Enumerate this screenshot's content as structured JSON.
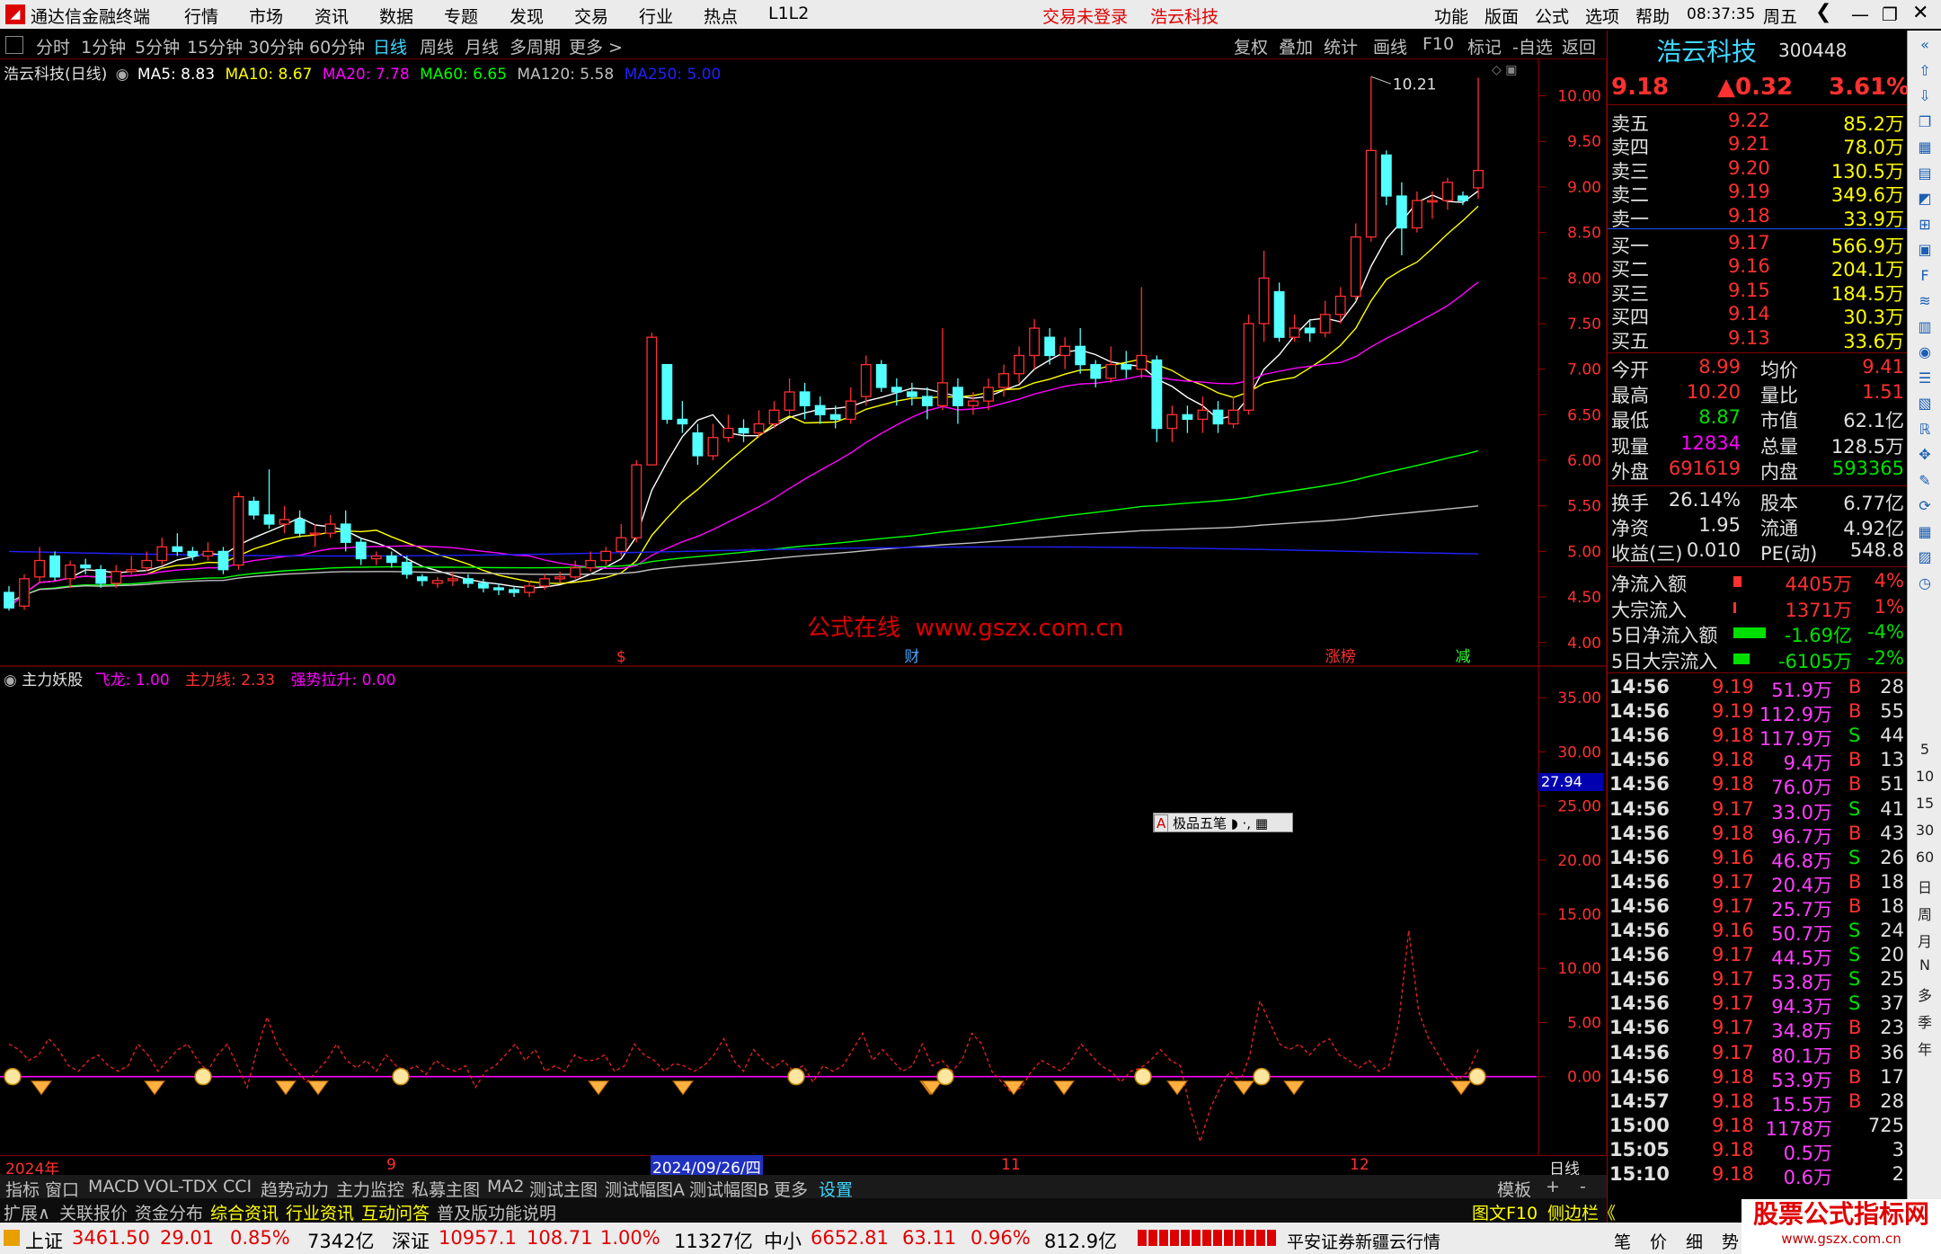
{
  "app": {
    "title": "通达信金融终端",
    "menu": [
      "行情",
      "市场",
      "资讯",
      "数据",
      "专题",
      "发现",
      "交易",
      "行业",
      "热点",
      "L1L2"
    ],
    "login_status": "交易未登录",
    "stock_name_title": "浩云科技",
    "right_menu": [
      "功能",
      "版面",
      "公式",
      "选项",
      "帮助"
    ],
    "time": "08:37:35",
    "weekday": "周五"
  },
  "periods": [
    "分时",
    "1分钟",
    "5分钟",
    "15分钟",
    "30分钟",
    "60分钟",
    "日线",
    "周线",
    "月线",
    "多周期",
    "更多 >"
  ],
  "active_period": "日线",
  "toolbar_right": [
    "复权",
    "叠加",
    "统计",
    "画线",
    "F10",
    "标记",
    "-自选",
    "返回"
  ],
  "main_chart": {
    "legend_title": "浩云科技(日线)",
    "ma": [
      {
        "label": "MA5: 8.83",
        "color": "#ffffff"
      },
      {
        "label": "MA10: 8.67",
        "color": "#ffff00"
      },
      {
        "label": "MA20: 7.78",
        "color": "#ff00ff"
      },
      {
        "label": "MA60: 6.65",
        "color": "#00ff00"
      },
      {
        "label": "MA120: 5.58",
        "color": "#c0c0c0"
      },
      {
        "label": "MA250: 5.00",
        "color": "#0000ff"
      }
    ],
    "high_label": "10.21",
    "watermark": "公式在线  www.gszx.com.cn",
    "markers": [
      {
        "text": "$",
        "color": "#ff3030"
      },
      {
        "text": "财",
        "color": "#4aa3ff"
      },
      {
        "text": "涨榜",
        "color": "#ff3030"
      },
      {
        "text": "减",
        "color": "#30ff30"
      }
    ]
  },
  "sub_chart": {
    "title": "主力妖股",
    "legend": [
      {
        "label": "飞龙: 1.00",
        "color": "#ff00ff"
      },
      {
        "label": "主力线: 2.33",
        "color": "#ff3030"
      },
      {
        "label": "强势拉升: 0.00",
        "color": "#ff00ff"
      }
    ],
    "current_value": "27.94",
    "popup_label": "极品五笔"
  },
  "chart_data": [
    {
      "type": "candlestick",
      "title": "浩云科技(日线)",
      "ylim": [
        3.85,
        10.4
      ],
      "y_ticks": [
        "10.00",
        "9.50",
        "9.00",
        "8.50",
        "8.00",
        "7.50",
        "7.00",
        "6.50",
        "6.00",
        "5.50",
        "5.00",
        "4.50",
        "4.00"
      ],
      "ohlc": [
        [
          4.55,
          4.38,
          4.62,
          4.35
        ],
        [
          4.4,
          4.7,
          4.75,
          4.36
        ],
        [
          4.72,
          4.9,
          5.05,
          4.65
        ],
        [
          4.95,
          4.72,
          5.0,
          4.68
        ],
        [
          4.7,
          4.85,
          4.9,
          4.6
        ],
        [
          4.85,
          4.82,
          4.92,
          4.75
        ],
        [
          4.8,
          4.65,
          4.85,
          4.6
        ],
        [
          4.65,
          4.78,
          4.85,
          4.6
        ],
        [
          4.78,
          4.8,
          4.95,
          4.75
        ],
        [
          4.82,
          4.9,
          5.0,
          4.78
        ],
        [
          4.9,
          5.05,
          5.15,
          4.85
        ],
        [
          5.05,
          5.0,
          5.2,
          4.95
        ],
        [
          5.0,
          4.95,
          5.05,
          4.9
        ],
        [
          4.95,
          5.0,
          5.1,
          4.9
        ],
        [
          5.0,
          4.8,
          5.05,
          4.75
        ],
        [
          4.85,
          5.6,
          5.65,
          4.8
        ],
        [
          5.55,
          5.4,
          5.6,
          5.35
        ],
        [
          5.4,
          5.3,
          5.9,
          5.25
        ],
        [
          5.3,
          5.35,
          5.5,
          5.2
        ],
        [
          5.35,
          5.2,
          5.45,
          5.15
        ],
        [
          5.2,
          5.2,
          5.3,
          5.05
        ],
        [
          5.2,
          5.3,
          5.4,
          5.15
        ],
        [
          5.3,
          5.1,
          5.45,
          5.0
        ],
        [
          5.1,
          4.92,
          5.15,
          4.85
        ],
        [
          4.92,
          4.95,
          5.0,
          4.85
        ],
        [
          4.95,
          4.88,
          5.0,
          4.82
        ],
        [
          4.88,
          4.75,
          4.95,
          4.7
        ],
        [
          4.72,
          4.68,
          4.75,
          4.62
        ],
        [
          4.65,
          4.68,
          4.72,
          4.6
        ],
        [
          4.68,
          4.7,
          4.78,
          4.62
        ],
        [
          4.7,
          4.65,
          4.75,
          4.6
        ],
        [
          4.65,
          4.6,
          4.7,
          4.55
        ],
        [
          4.6,
          4.58,
          4.65,
          4.52
        ],
        [
          4.58,
          4.55,
          4.62,
          4.5
        ],
        [
          4.55,
          4.62,
          4.68,
          4.5
        ],
        [
          4.62,
          4.7,
          4.75,
          4.58
        ],
        [
          4.7,
          4.72,
          4.78,
          4.65
        ],
        [
          4.72,
          4.82,
          4.9,
          4.7
        ],
        [
          4.82,
          4.9,
          5.0,
          4.78
        ],
        [
          4.9,
          5.0,
          5.05,
          4.85
        ],
        [
          5.0,
          5.15,
          5.3,
          4.95
        ],
        [
          5.15,
          5.95,
          6.0,
          5.1
        ],
        [
          5.95,
          7.35,
          7.4,
          5.95
        ],
        [
          7.05,
          6.45,
          7.05,
          6.4
        ],
        [
          6.45,
          6.4,
          6.65,
          6.3
        ],
        [
          6.3,
          6.05,
          6.4,
          5.95
        ],
        [
          6.05,
          6.25,
          6.4,
          6.0
        ],
        [
          6.25,
          6.35,
          6.5,
          6.2
        ],
        [
          6.35,
          6.3,
          6.45,
          6.2
        ],
        [
          6.3,
          6.4,
          6.55,
          6.25
        ],
        [
          6.4,
          6.55,
          6.65,
          6.35
        ],
        [
          6.55,
          6.75,
          6.9,
          6.5
        ],
        [
          6.75,
          6.6,
          6.85,
          6.45
        ],
        [
          6.6,
          6.5,
          6.7,
          6.4
        ],
        [
          6.5,
          6.45,
          6.6,
          6.35
        ],
        [
          6.45,
          6.65,
          6.8,
          6.4
        ],
        [
          6.7,
          7.05,
          7.15,
          6.6
        ],
        [
          7.05,
          6.8,
          7.1,
          6.75
        ],
        [
          6.8,
          6.75,
          6.9,
          6.6
        ],
        [
          6.75,
          6.7,
          6.85,
          6.6
        ],
        [
          6.7,
          6.6,
          6.8,
          6.45
        ],
        [
          6.6,
          6.85,
          7.45,
          6.55
        ],
        [
          6.8,
          6.6,
          6.9,
          6.4
        ],
        [
          6.6,
          6.65,
          6.75,
          6.5
        ],
        [
          6.65,
          6.8,
          6.9,
          6.55
        ],
        [
          6.8,
          6.95,
          7.05,
          6.7
        ],
        [
          6.95,
          7.15,
          7.25,
          6.85
        ],
        [
          7.15,
          7.45,
          7.55,
          7.0
        ],
        [
          7.35,
          7.15,
          7.45,
          7.05
        ],
        [
          7.15,
          7.25,
          7.35,
          7.0
        ],
        [
          7.25,
          7.05,
          7.45,
          6.95
        ],
        [
          7.05,
          6.9,
          7.1,
          6.8
        ],
        [
          6.9,
          7.05,
          7.25,
          6.85
        ],
        [
          7.05,
          7.0,
          7.2,
          6.9
        ],
        [
          7.0,
          7.15,
          7.9,
          6.9
        ],
        [
          7.1,
          6.35,
          7.15,
          6.2
        ],
        [
          6.35,
          6.5,
          6.6,
          6.2
        ],
        [
          6.5,
          6.45,
          6.6,
          6.3
        ],
        [
          6.45,
          6.55,
          6.7,
          6.3
        ],
        [
          6.55,
          6.4,
          6.65,
          6.3
        ],
        [
          6.4,
          6.55,
          6.7,
          6.35
        ],
        [
          6.55,
          7.5,
          7.6,
          6.5
        ],
        [
          7.5,
          8.0,
          8.3,
          7.3
        ],
        [
          7.85,
          7.35,
          7.95,
          7.3
        ],
        [
          7.35,
          7.45,
          7.6,
          7.3
        ],
        [
          7.45,
          7.4,
          7.55,
          7.3
        ],
        [
          7.4,
          7.6,
          7.75,
          7.35
        ],
        [
          7.6,
          7.8,
          7.9,
          7.5
        ],
        [
          7.8,
          8.45,
          8.6,
          7.75
        ],
        [
          8.45,
          9.4,
          10.21,
          8.4
        ],
        [
          9.35,
          8.9,
          9.4,
          8.8
        ],
        [
          8.9,
          8.55,
          9.05,
          8.25
        ],
        [
          8.55,
          8.85,
          8.95,
          8.5
        ],
        [
          8.85,
          8.85,
          8.95,
          8.65
        ],
        [
          8.85,
          9.05,
          9.1,
          8.75
        ],
        [
          8.9,
          8.85,
          8.95,
          8.8
        ],
        [
          8.99,
          9.18,
          10.2,
          8.87
        ]
      ]
    },
    {
      "type": "line",
      "title": "主力妖股",
      "ylim": [
        -7,
        37
      ],
      "y_ticks": [
        "35.00",
        "30.00",
        "25.00",
        "20.00",
        "15.00",
        "10.00",
        "5.00",
        "0.00"
      ],
      "series": [
        {
          "name": "主力线",
          "values": [
            3,
            2.5,
            1.5,
            2,
            3.5,
            2.5,
            1,
            0.5,
            1.5,
            2,
            1,
            0.5,
            1,
            3,
            2,
            0.5,
            1.5,
            2.5,
            3,
            1.5,
            0.5,
            2,
            3,
            1,
            -1,
            2.5,
            5.5,
            3,
            1.5,
            0.5,
            -0.5,
            0.5,
            1.5,
            3,
            1.5,
            0.8,
            1.5,
            0.5,
            2,
            1,
            0.5,
            1,
            0.2,
            1.5,
            0.8,
            0.5,
            1,
            -1,
            0.5,
            1,
            2,
            3,
            1.5,
            2.5,
            0.5,
            1,
            0.5,
            2,
            1.5,
            1.5,
            2,
            0.5,
            1,
            3,
            2,
            1.5,
            0.5,
            1.2,
            1,
            0.5,
            1,
            2,
            3.5,
            1.5,
            0.5,
            2.5,
            1.5,
            0.8,
            1.5,
            0.5,
            1,
            -0.5,
            1,
            0.5,
            1,
            2.5,
            4,
            1.5,
            2.5,
            1.5,
            0.5,
            1,
            3,
            1,
            1.5,
            0.5,
            1.5,
            4,
            3,
            0.5,
            -0.5,
            -1.5,
            -1,
            0.5,
            1.5,
            1,
            0.5,
            1.5,
            3,
            2,
            1,
            0.5,
            -0.5,
            0.5,
            0.8,
            1.5,
            2.5,
            1.5,
            1,
            -3,
            -6,
            -3,
            -1,
            0.5,
            -0.5,
            2,
            7,
            5,
            3,
            2.5,
            3,
            2,
            3,
            3.5,
            2,
            1.5,
            0.8,
            1.5,
            0.5,
            1,
            5,
            13.5,
            6,
            3.5,
            2,
            0.5,
            -0.3,
            0.5,
            2.5
          ]
        }
      ]
    }
  ],
  "axis_dates": [
    "2024年",
    "9",
    "2024/09/26/四",
    "11",
    "12"
  ],
  "axis_right_label": "日线",
  "bottom_tabs": [
    "指标",
    "窗口",
    "MACD",
    "VOL-TDX",
    "CCI",
    "趋势动力",
    "主力监控",
    "私募主图",
    "MA2",
    "测试主图",
    "测试幅图A",
    "测试幅图B",
    "更多",
    "设置"
  ],
  "bottom_tabs_right": [
    "模板",
    "+",
    "-"
  ],
  "info_tabs": [
    "扩展∧",
    "关联报价",
    "资金分布",
    "综合资讯",
    "行业资讯",
    "互动问答",
    "普及版功能说明"
  ],
  "info_tabs_right": [
    "图文F10",
    "侧边栏《",
    "笔",
    "价",
    "细",
    "势"
  ],
  "quote": {
    "name": "浩云科技",
    "code": "300448",
    "price": "9.18",
    "change": "▲0.32",
    "pct": "3.61%",
    "asks": [
      {
        "label": "卖五",
        "price": "9.22",
        "vol": "85.2万"
      },
      {
        "label": "卖四",
        "price": "9.21",
        "vol": "78.0万"
      },
      {
        "label": "卖三",
        "price": "9.20",
        "vol": "130.5万"
      },
      {
        "label": "卖二",
        "price": "9.19",
        "vol": "349.6万"
      },
      {
        "label": "卖一",
        "price": "9.18",
        "vol": "33.9万"
      }
    ],
    "bids": [
      {
        "label": "买一",
        "price": "9.17",
        "vol": "566.9万"
      },
      {
        "label": "买二",
        "price": "9.16",
        "vol": "204.1万"
      },
      {
        "label": "买三",
        "price": "9.15",
        "vol": "184.5万"
      },
      {
        "label": "买四",
        "price": "9.14",
        "vol": "30.3万"
      },
      {
        "label": "买五",
        "price": "9.13",
        "vol": "33.6万"
      }
    ],
    "stats": [
      {
        "l1": "今开",
        "v1": "8.99",
        "c1": "#ff3030",
        "l2": "均价",
        "v2": "9.41",
        "c2": "#ff3030"
      },
      {
        "l1": "最高",
        "v1": "10.20",
        "c1": "#ff3030",
        "l2": "量比",
        "v2": "1.51",
        "c2": "#ff3030"
      },
      {
        "l1": "最低",
        "v1": "8.87",
        "c1": "#00e000",
        "l2": "市值",
        "v2": "62.1亿",
        "c2": "#e0e0e0"
      },
      {
        "l1": "现量",
        "v1": "12834",
        "c1": "#ff00ff",
        "l2": "总量",
        "v2": "128.5万",
        "c2": "#e0e0e0"
      },
      {
        "l1": "外盘",
        "v1": "691619",
        "c1": "#ff3030",
        "l2": "内盘",
        "v2": "593365",
        "c2": "#00e000"
      }
    ],
    "stats2": [
      {
        "l1": "换手",
        "v1": "26.14%",
        "l2": "股本",
        "v2": "6.77亿"
      },
      {
        "l1": "净资",
        "v1": "1.95",
        "l2": "流通",
        "v2": "4.92亿"
      },
      {
        "l1": "收益(三)",
        "v1": "0.010",
        "l2": "PE(动)",
        "v2": "548.8"
      }
    ],
    "flows": [
      {
        "label": "净流入额",
        "value": "4405万",
        "pct": "4%",
        "color": "#ff3030",
        "bar": 0.15
      },
      {
        "label": "大宗流入",
        "value": "1371万",
        "pct": "1%",
        "color": "#ff3030",
        "bar": 0.05
      },
      {
        "label": "5日净流入额",
        "value": "-1.69亿",
        "pct": "-4%",
        "color": "#00e000",
        "bar": 0.6
      },
      {
        "label": "5日大宗流入",
        "value": "-6105万",
        "pct": "-2%",
        "color": "#00e000",
        "bar": 0.3
      }
    ],
    "ticks": [
      [
        "14:56",
        "9.19",
        "51.9万",
        "B",
        "28"
      ],
      [
        "14:56",
        "9.19",
        "112.9万",
        "B",
        "55"
      ],
      [
        "14:56",
        "9.18",
        "117.9万",
        "S",
        "44"
      ],
      [
        "14:56",
        "9.18",
        "9.4万",
        "B",
        "13"
      ],
      [
        "14:56",
        "9.18",
        "76.0万",
        "B",
        "51"
      ],
      [
        "14:56",
        "9.17",
        "33.0万",
        "S",
        "41"
      ],
      [
        "14:56",
        "9.18",
        "96.7万",
        "B",
        "43"
      ],
      [
        "14:56",
        "9.16",
        "46.8万",
        "S",
        "26"
      ],
      [
        "14:56",
        "9.17",
        "20.4万",
        "B",
        "18"
      ],
      [
        "14:56",
        "9.17",
        "25.7万",
        "B",
        "18"
      ],
      [
        "14:56",
        "9.16",
        "50.7万",
        "S",
        "24"
      ],
      [
        "14:56",
        "9.17",
        "44.5万",
        "S",
        "20"
      ],
      [
        "14:56",
        "9.17",
        "53.8万",
        "S",
        "25"
      ],
      [
        "14:56",
        "9.17",
        "94.3万",
        "S",
        "37"
      ],
      [
        "14:56",
        "9.17",
        "34.8万",
        "B",
        "23"
      ],
      [
        "14:56",
        "9.17",
        "80.1万",
        "B",
        "36"
      ],
      [
        "14:56",
        "9.18",
        "53.9万",
        "B",
        "17"
      ],
      [
        "14:57",
        "9.18",
        "15.5万",
        "B",
        "28"
      ],
      [
        "15:00",
        "9.18",
        "1178万",
        "",
        "725"
      ],
      [
        "15:05",
        "9.18",
        "0.5万",
        "",
        "3"
      ],
      [
        "15:10",
        "9.18",
        "0.6万",
        "",
        "2"
      ]
    ]
  },
  "market_status": {
    "sh_label": "上证",
    "sh_value": "3461.50",
    "sh_change": "29.01",
    "sh_pct": "0.85%",
    "sh_amount": "7342亿",
    "sz_label": "深证",
    "sz_value": "10957.1",
    "sz_change": "108.71",
    "sz_pct": "1.00%",
    "sz_amount": "11327亿",
    "zx_label": "中小",
    "zx_value": "6652.81",
    "zx_change": "63.11",
    "zx_pct": "0.96%",
    "zx_amount": "812.9亿",
    "broker": "平安证券新疆云行情"
  },
  "brand_watermark": {
    "line1": "股票公式指标网",
    "line2": "www.gszx.com.cn"
  },
  "side_icons": [
    "collapse-icon",
    "up-icon",
    "down-icon",
    "copy-icon",
    "grid-icon",
    "table-icon",
    "chart-icon",
    "kline-icon",
    "news-icon",
    "f10-icon",
    "flow-icon",
    "level-icon",
    "hot-icon",
    "list-icon",
    "fund-icon",
    "rsi-icon",
    "move-icon",
    "pen-icon",
    "refresh-icon",
    "grid2-icon",
    "calc-icon",
    "clock-icon"
  ],
  "side_labels": [
    "5",
    "10",
    "15",
    "30",
    "60",
    "日",
    "周",
    "月",
    "N",
    "多",
    "季",
    "年"
  ]
}
